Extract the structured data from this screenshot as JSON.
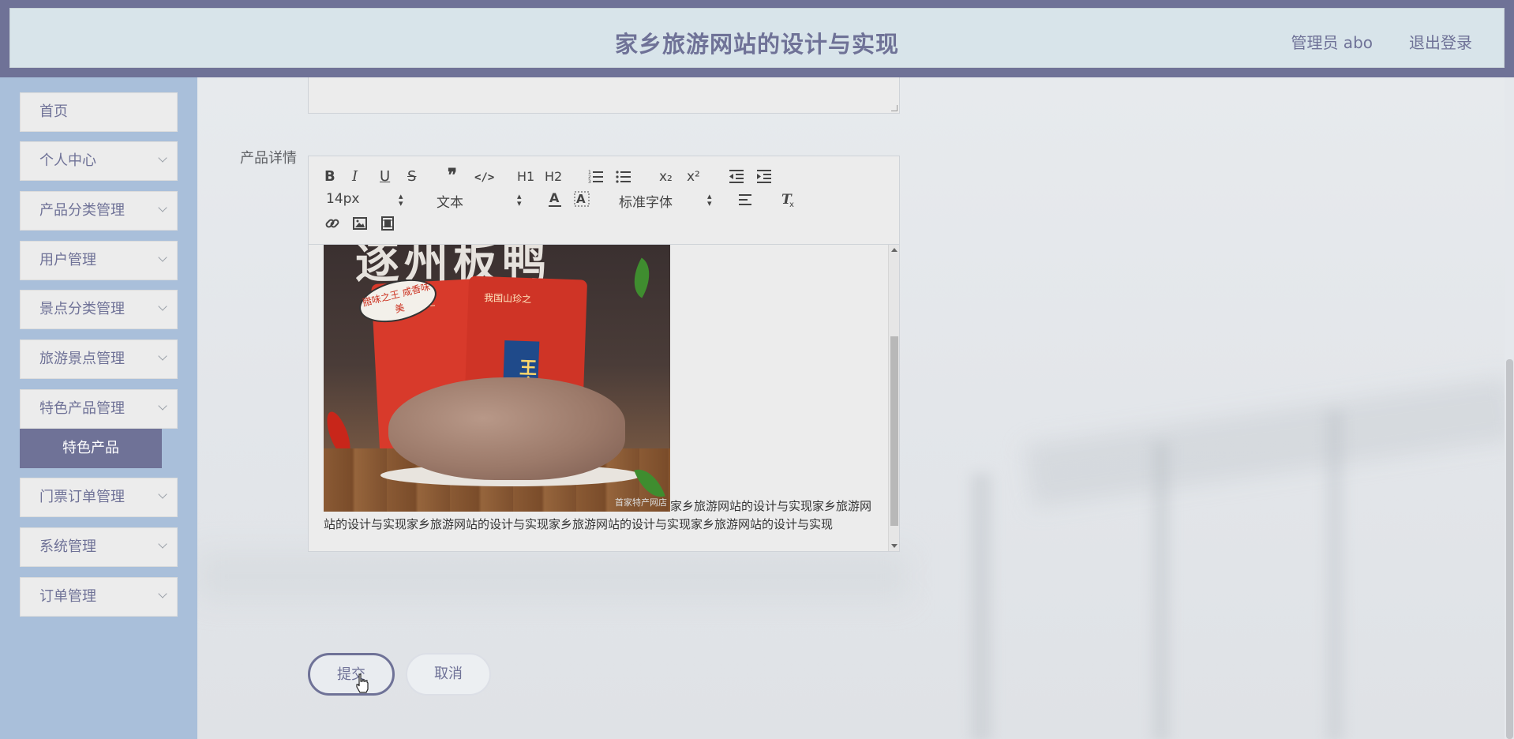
{
  "header": {
    "title": "家乡旅游网站的设计与实现",
    "user": "管理员 abo",
    "logout": "退出登录"
  },
  "sidebar": {
    "items": [
      {
        "label": "首页",
        "has_children": false
      },
      {
        "label": "个人中心",
        "has_children": true
      },
      {
        "label": "产品分类管理",
        "has_children": true
      },
      {
        "label": "用户管理",
        "has_children": true
      },
      {
        "label": "景点分类管理",
        "has_children": true
      },
      {
        "label": "旅游景点管理",
        "has_children": true
      },
      {
        "label": "特色产品管理",
        "has_children": true
      },
      {
        "label": "门票订单管理",
        "has_children": true
      },
      {
        "label": "系统管理",
        "has_children": true
      },
      {
        "label": "订单管理",
        "has_children": true
      }
    ],
    "active_sub": "特色产品"
  },
  "form": {
    "detail_label": "产品详情",
    "editor": {
      "toolbar": {
        "bold": "B",
        "italic": "I",
        "underline": "U",
        "strike": "S",
        "quote": "❞",
        "code": "</>",
        "h1": "H1",
        "h2": "H2",
        "subscript": "x₂",
        "superscript": "x²",
        "font_size": "14px",
        "header_select": "文本",
        "font_family": "标准字体"
      },
      "image_caption_text": {
        "title": "逐州板鸭",
        "bag_top": "我国山珍之",
        "bag_label": "王府辣",
        "bubble": "腊味之王 咸香味美",
        "watermark": "首家特产网店"
      },
      "content_text": "家乡旅游网站的设计与实现家乡旅游网站的设计与实现家乡旅游网站的设计与实现家乡旅游网站的设计与实现家乡旅游网站的设计与实现"
    },
    "submit_label": "提交",
    "cancel_label": "取消"
  },
  "colors": {
    "accent": "#6f7297",
    "header_bg": "#d8e4ea",
    "sidebar_bg": "#a9bfda",
    "menu_bg": "#ececec"
  }
}
